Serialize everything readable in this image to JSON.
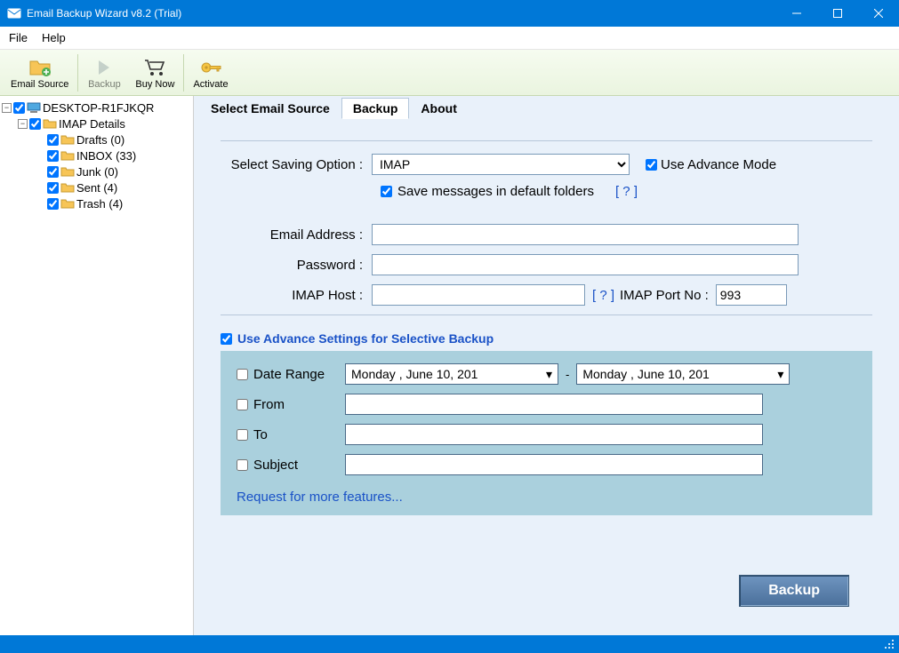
{
  "window": {
    "title": "Email Backup Wizard v8.2 (Trial)"
  },
  "menubar": {
    "file": "File",
    "help": "Help"
  },
  "toolbar": {
    "email_source": "Email Source",
    "backup": "Backup",
    "buy_now": "Buy Now",
    "activate": "Activate"
  },
  "tree": {
    "root": "DESKTOP-R1FJKQR",
    "imap_details": "IMAP Details",
    "folders": [
      {
        "label": "Drafts (0)"
      },
      {
        "label": "INBOX (33)"
      },
      {
        "label": "Junk (0)"
      },
      {
        "label": "Sent (4)"
      },
      {
        "label": "Trash (4)"
      }
    ]
  },
  "tabs": {
    "select_source": "Select Email Source",
    "backup": "Backup",
    "about": "About"
  },
  "form": {
    "saving_option_label": "Select Saving Option :",
    "saving_option_value": "IMAP",
    "use_advance_mode": "Use Advance Mode",
    "save_default": "Save messages in default folders",
    "help_q": "[ ? ]",
    "email_label": "Email Address :",
    "password_label": "Password :",
    "host_label": "IMAP Host :",
    "port_label": "IMAP Port No :",
    "port_value": "993"
  },
  "advance": {
    "header": "Use Advance Settings for Selective Backup",
    "date_range": "Date Range",
    "date_from": "Monday   ,     June     10, 201",
    "date_to": "Monday   ,     June     10, 201",
    "from": "From",
    "to": "To",
    "subject": "Subject",
    "request": "Request for more features..."
  },
  "buttons": {
    "backup": "Backup"
  }
}
